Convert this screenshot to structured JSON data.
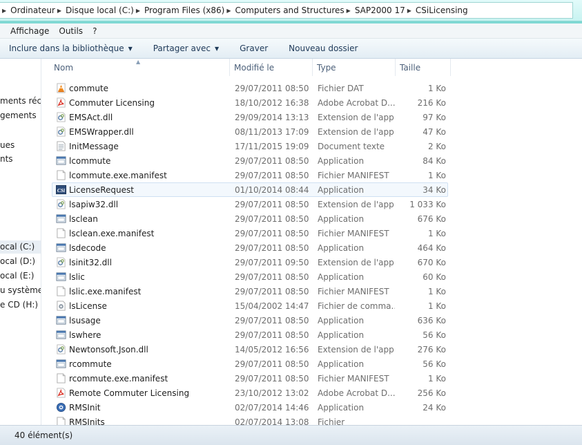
{
  "address": {
    "crumbs": [
      "Ordinateur",
      "Disque local (C:)",
      "Program Files (x86)",
      "Computers and Structures",
      "SAP2000 17",
      "CSiLicensing"
    ]
  },
  "menu": [
    "Affichage",
    "Outils",
    "?"
  ],
  "commands": {
    "library": "Inclure dans la bibliothèque",
    "share": "Partager avec",
    "burn": "Graver",
    "new_folder": "Nouveau dossier"
  },
  "nav": {
    "items": [
      "ments récen",
      "gements",
      "ues",
      "nts",
      "ocal (C:)",
      "ocal (D:)",
      "ocal (E:)",
      "u système",
      "e CD (H:)"
    ]
  },
  "columns": {
    "name": "Nom",
    "date": "Modifié le",
    "type": "Type",
    "size": "Taille"
  },
  "files": [
    {
      "name": "commute",
      "date": "29/07/2011 08:50",
      "type": "Fichier DAT",
      "size": "1 Ko",
      "icon": "vlc-cone-icon"
    },
    {
      "name": "Commuter Licensing",
      "date": "18/10/2012 16:38",
      "type": "Adobe Acrobat D...",
      "size": "216 Ko",
      "icon": "pdf-icon"
    },
    {
      "name": "EMSAct.dll",
      "date": "29/09/2014 13:13",
      "type": "Extension de l'app...",
      "size": "97 Ko",
      "icon": "dll-icon"
    },
    {
      "name": "EMSWrapper.dll",
      "date": "08/11/2013 17:09",
      "type": "Extension de l'app...",
      "size": "47 Ko",
      "icon": "dll-icon"
    },
    {
      "name": "InitMessage",
      "date": "17/11/2015 19:09",
      "type": "Document texte",
      "size": "2 Ko",
      "icon": "text-file-icon"
    },
    {
      "name": "lcommute",
      "date": "29/07/2011 08:50",
      "type": "Application",
      "size": "84 Ko",
      "icon": "application-icon"
    },
    {
      "name": "lcommute.exe.manifest",
      "date": "29/07/2011 08:50",
      "type": "Fichier MANIFEST",
      "size": "1 Ko",
      "icon": "blank-file-icon"
    },
    {
      "name": "LicenseRequest",
      "date": "01/10/2014 08:44",
      "type": "Application",
      "size": "34 Ko",
      "icon": "csi-app-icon"
    },
    {
      "name": "lsapiw32.dll",
      "date": "29/07/2011 08:50",
      "type": "Extension de l'app...",
      "size": "1 033 Ko",
      "icon": "dll-icon"
    },
    {
      "name": "lsclean",
      "date": "29/07/2011 08:50",
      "type": "Application",
      "size": "676 Ko",
      "icon": "application-icon"
    },
    {
      "name": "lsclean.exe.manifest",
      "date": "29/07/2011 08:50",
      "type": "Fichier MANIFEST",
      "size": "1 Ko",
      "icon": "blank-file-icon"
    },
    {
      "name": "lsdecode",
      "date": "29/07/2011 08:50",
      "type": "Application",
      "size": "464 Ko",
      "icon": "application-icon"
    },
    {
      "name": "lsinit32.dll",
      "date": "29/07/2011 09:50",
      "type": "Extension de l'app...",
      "size": "670 Ko",
      "icon": "dll-icon"
    },
    {
      "name": "lslic",
      "date": "29/07/2011 08:50",
      "type": "Application",
      "size": "60 Ko",
      "icon": "application-icon"
    },
    {
      "name": "lslic.exe.manifest",
      "date": "29/07/2011 08:50",
      "type": "Fichier MANIFEST",
      "size": "1 Ko",
      "icon": "blank-file-icon"
    },
    {
      "name": "lsLicense",
      "date": "15/04/2002 14:47",
      "type": "Fichier de comma...",
      "size": "1 Ko",
      "icon": "batch-file-icon"
    },
    {
      "name": "lsusage",
      "date": "29/07/2011 08:50",
      "type": "Application",
      "size": "636 Ko",
      "icon": "application-icon"
    },
    {
      "name": "lswhere",
      "date": "29/07/2011 08:50",
      "type": "Application",
      "size": "56 Ko",
      "icon": "application-icon"
    },
    {
      "name": "Newtonsoft.Json.dll",
      "date": "14/05/2012 16:56",
      "type": "Extension de l'app...",
      "size": "276 Ko",
      "icon": "dll-icon"
    },
    {
      "name": "rcommute",
      "date": "29/07/2011 08:50",
      "type": "Application",
      "size": "56 Ko",
      "icon": "application-icon"
    },
    {
      "name": "rcommute.exe.manifest",
      "date": "29/07/2011 08:50",
      "type": "Fichier MANIFEST",
      "size": "1 Ko",
      "icon": "blank-file-icon"
    },
    {
      "name": "Remote Commuter Licensing",
      "date": "23/10/2012 13:02",
      "type": "Adobe Acrobat D...",
      "size": "256 Ko",
      "icon": "pdf-icon"
    },
    {
      "name": "RMSInit",
      "date": "02/07/2014 14:46",
      "type": "Application",
      "size": "24 Ko",
      "icon": "rms-app-icon"
    },
    {
      "name": "RMSInits",
      "date": "02/07/2014 13:08",
      "type": "Fichier",
      "size": "",
      "icon": "blank-file-icon"
    }
  ],
  "hover_row": "LicenseRequest",
  "status": {
    "count": "40 élément(s)"
  }
}
